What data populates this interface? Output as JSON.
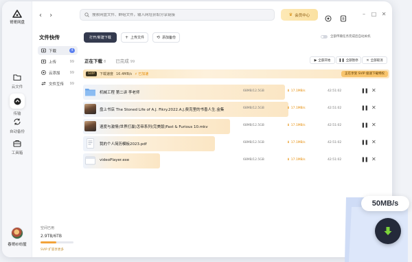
{
  "app": {
    "logo_text": "哥哥网盘",
    "rail": [
      {
        "label": "云文件",
        "icon": "folder-icon"
      },
      {
        "label": "传输",
        "icon": "transfer-icon"
      },
      {
        "label": "自动备份",
        "icon": "backup-icon"
      },
      {
        "label": "工具箱",
        "icon": "toolbox-icon"
      }
    ],
    "user_name": "春哥纱纷屋"
  },
  "topbar": {
    "search_placeholder": "搜索网盘文件、群组文件，输入网址获取分享链接",
    "vip_label": "会员中心"
  },
  "sidebar": {
    "title": "文件快传",
    "items": [
      {
        "label": "下载",
        "count": "4",
        "is_badge": true
      },
      {
        "label": "上传",
        "count": "99",
        "is_badge": false
      },
      {
        "label": "云添加",
        "count": "99",
        "is_badge": false
      },
      {
        "label": "文件互传",
        "count": "99",
        "is_badge": false
      }
    ],
    "storage_label": "空间已用",
    "storage_value": "2.9TB/6TB",
    "storage_fraction": 0.48,
    "storage_promo": "SVIP 扩容享更多"
  },
  "toolbar": {
    "primary_label": "打开/新建下载",
    "upload_label": "上传文件",
    "backup_label": "添加备份",
    "toggle_label": "全部传输任务完成后自动关机"
  },
  "tabs": [
    {
      "label": "正在下载",
      "count": "8"
    },
    {
      "label": "已完成",
      "count": "99"
    }
  ],
  "actions": {
    "start_all": "全部开始",
    "pause_all": "全部暂停",
    "cancel_all": "全部取消"
  },
  "status": {
    "tag": "SVIP",
    "label": "下载速度",
    "speed": "16.4MB/s",
    "boost": "已加速",
    "right_text": "正在享受 SVIP 极速下载特权"
  },
  "downloads": [
    {
      "name": "机械工程 第二讲 李老师",
      "size": "68MB/12.5GB",
      "speed": "17.1MB/s",
      "time": "42:51:02",
      "progress": 0.66,
      "thumb": "folder"
    },
    {
      "name": "盘上书店 The Stoned Life of A.J. Fikry.2022.A.J.费克里的书香人生.金集",
      "size": "68MB/12.5GB",
      "speed": "17.1MB/s",
      "time": "42:51:02",
      "progress": 0.67,
      "thumb": "film"
    },
    {
      "name": "速度与激情(世界打赢)怎帝系列(完美版)Fast & Furious 10.mkv",
      "size": "68MB/12.5GB",
      "speed": "17.1MB/s",
      "time": "42:51:02",
      "progress": 0.48,
      "thumb": "film"
    },
    {
      "name": "我的个人简历模板2023.pdf",
      "size": "68MB/12.5GB",
      "speed": "17.1MB/s",
      "time": "42:51:02",
      "progress": 0.43,
      "thumb": "doc"
    },
    {
      "name": "videoPlayer.exe",
      "size": "68MB/12.5GB",
      "speed": "17.1MB/s",
      "time": "42:51:02",
      "progress": 0.25,
      "thumb": "exe"
    }
  ],
  "overlay": {
    "speed_badge": "50MB/s"
  },
  "colors": {
    "accent_orange": "#e58a00",
    "dark": "#343a4e",
    "download_green": "#7cd43a"
  }
}
